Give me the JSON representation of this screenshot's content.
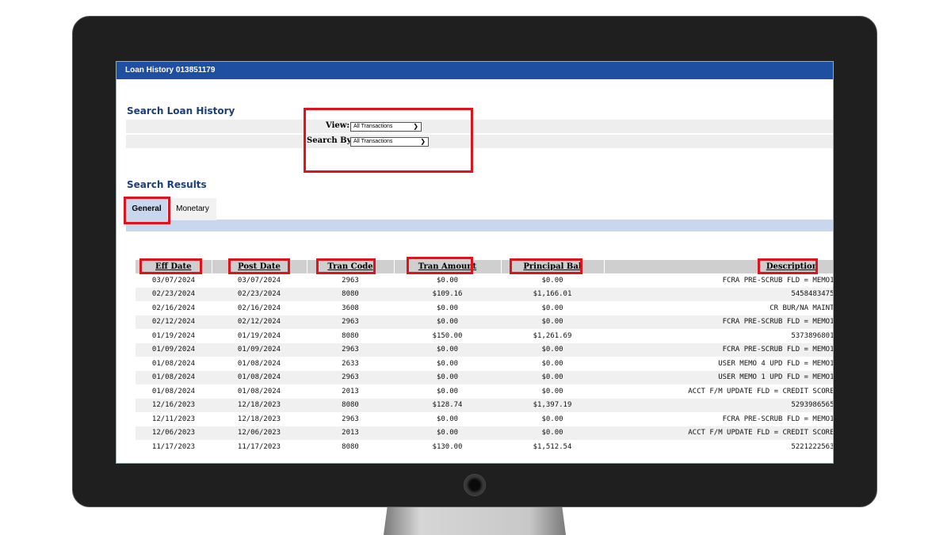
{
  "window": {
    "title": "Loan History 013851179"
  },
  "search": {
    "heading": "Search Loan History",
    "view_label": "View:",
    "view_value": "All Transactions",
    "search_by_label": "Search By:",
    "search_by_value": "All Transactions"
  },
  "results": {
    "heading": "Search Results",
    "tabs": [
      {
        "label": "General",
        "active": true
      },
      {
        "label": "Monetary",
        "active": false
      }
    ],
    "columns": [
      "Eff Date",
      "Post Date",
      "Tran Code",
      "Tran Amount",
      "Principal Bal",
      "Description"
    ],
    "rows": [
      [
        "03/07/2024",
        "03/07/2024",
        "2963",
        "$0.00",
        "$0.00",
        "FCRA PRE-SCRUB FLD = MEMO1"
      ],
      [
        "02/23/2024",
        "02/23/2024",
        "8080",
        "$109.16",
        "$1,166.01",
        "5458483475"
      ],
      [
        "02/16/2024",
        "02/16/2024",
        "3608",
        "$0.00",
        "$0.00",
        "CR BUR/NA MAINT"
      ],
      [
        "02/12/2024",
        "02/12/2024",
        "2963",
        "$0.00",
        "$0.00",
        "FCRA PRE-SCRUB FLD = MEMO1"
      ],
      [
        "01/19/2024",
        "01/19/2024",
        "8080",
        "$150.00",
        "$1,261.69",
        "5373896801"
      ],
      [
        "01/09/2024",
        "01/09/2024",
        "2963",
        "$0.00",
        "$0.00",
        "FCRA PRE-SCRUB FLD = MEMO1"
      ],
      [
        "01/08/2024",
        "01/08/2024",
        "2633",
        "$0.00",
        "$0.00",
        "USER MEMO 4 UPD FLD = MEMO1"
      ],
      [
        "01/08/2024",
        "01/08/2024",
        "2963",
        "$0.00",
        "$0.00",
        "USER MEMO 1 UPD FLD = MEMO1"
      ],
      [
        "01/08/2024",
        "01/08/2024",
        "2013",
        "$0.00",
        "$0.00",
        "ACCT F/M UPDATE FLD = CREDIT SCORE"
      ],
      [
        "12/16/2023",
        "12/18/2023",
        "8080",
        "$128.74",
        "$1,397.19",
        "5293986565"
      ],
      [
        "12/11/2023",
        "12/18/2023",
        "2963",
        "$0.00",
        "$0.00",
        "FCRA PRE-SCRUB FLD = MEMO1"
      ],
      [
        "12/06/2023",
        "12/06/2023",
        "2013",
        "$0.00",
        "$0.00",
        "ACCT F/M UPDATE FLD = CREDIT SCORE"
      ],
      [
        "11/17/2023",
        "11/17/2023",
        "8080",
        "$130.00",
        "$1,512.54",
        "5221222563"
      ]
    ]
  },
  "colors": {
    "titlebar": "#1f4fa0",
    "heading": "#1a3f7a",
    "highlight": "#e0121b",
    "tab_active": "#c9d7ee",
    "bezel": "#1f1f1f"
  },
  "icons": {
    "select_chevron": "chevron-down-icon"
  }
}
